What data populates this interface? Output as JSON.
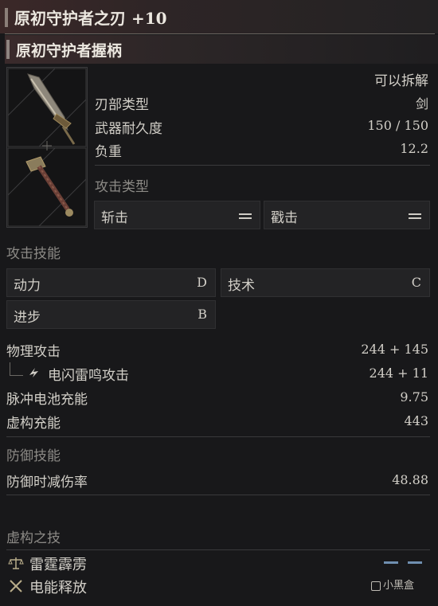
{
  "header": {
    "title": "原初守护者之刃 +10"
  },
  "component": {
    "title": "原初守护者握柄"
  },
  "stats": {
    "dismantle": "可以拆解",
    "rows": [
      {
        "label": "刃部类型",
        "value": "剑"
      },
      {
        "label": "武器耐久度",
        "value": "150 / 150"
      },
      {
        "label": "负重",
        "value": "12.2"
      }
    ]
  },
  "attack_types": {
    "title": "攻击类型",
    "items": [
      {
        "label": "斩击"
      },
      {
        "label": "戳击"
      }
    ]
  },
  "attack_skills": {
    "title": "攻击技能",
    "items": [
      {
        "label": "动力",
        "grade": "D"
      },
      {
        "label": "技术",
        "grade": "C"
      },
      {
        "label": "进步",
        "grade": "B"
      }
    ]
  },
  "attack_stats": [
    {
      "label": "物理攻击",
      "value": "244 + 145"
    },
    {
      "label": "电闪雷鸣攻击",
      "value": "244 + 11"
    },
    {
      "label": "脉冲电池充能",
      "value": "9.75"
    },
    {
      "label": "虚构充能",
      "value": "443"
    }
  ],
  "defense": {
    "title": "防御技能",
    "label": "防御时减伤率",
    "value": "48.88"
  },
  "fable": {
    "title": "虚构之技",
    "items": [
      {
        "label": "雷霆霹雳"
      },
      {
        "label": "电能释放"
      }
    ]
  },
  "watermark": "小黑盒",
  "colors": {
    "accent_blue": "#6f8fb0",
    "header_red": "#3b2828"
  },
  "icons": [
    "lightning-icon",
    "balance-icon",
    "crossed-swords-icon",
    "equals-icon"
  ]
}
